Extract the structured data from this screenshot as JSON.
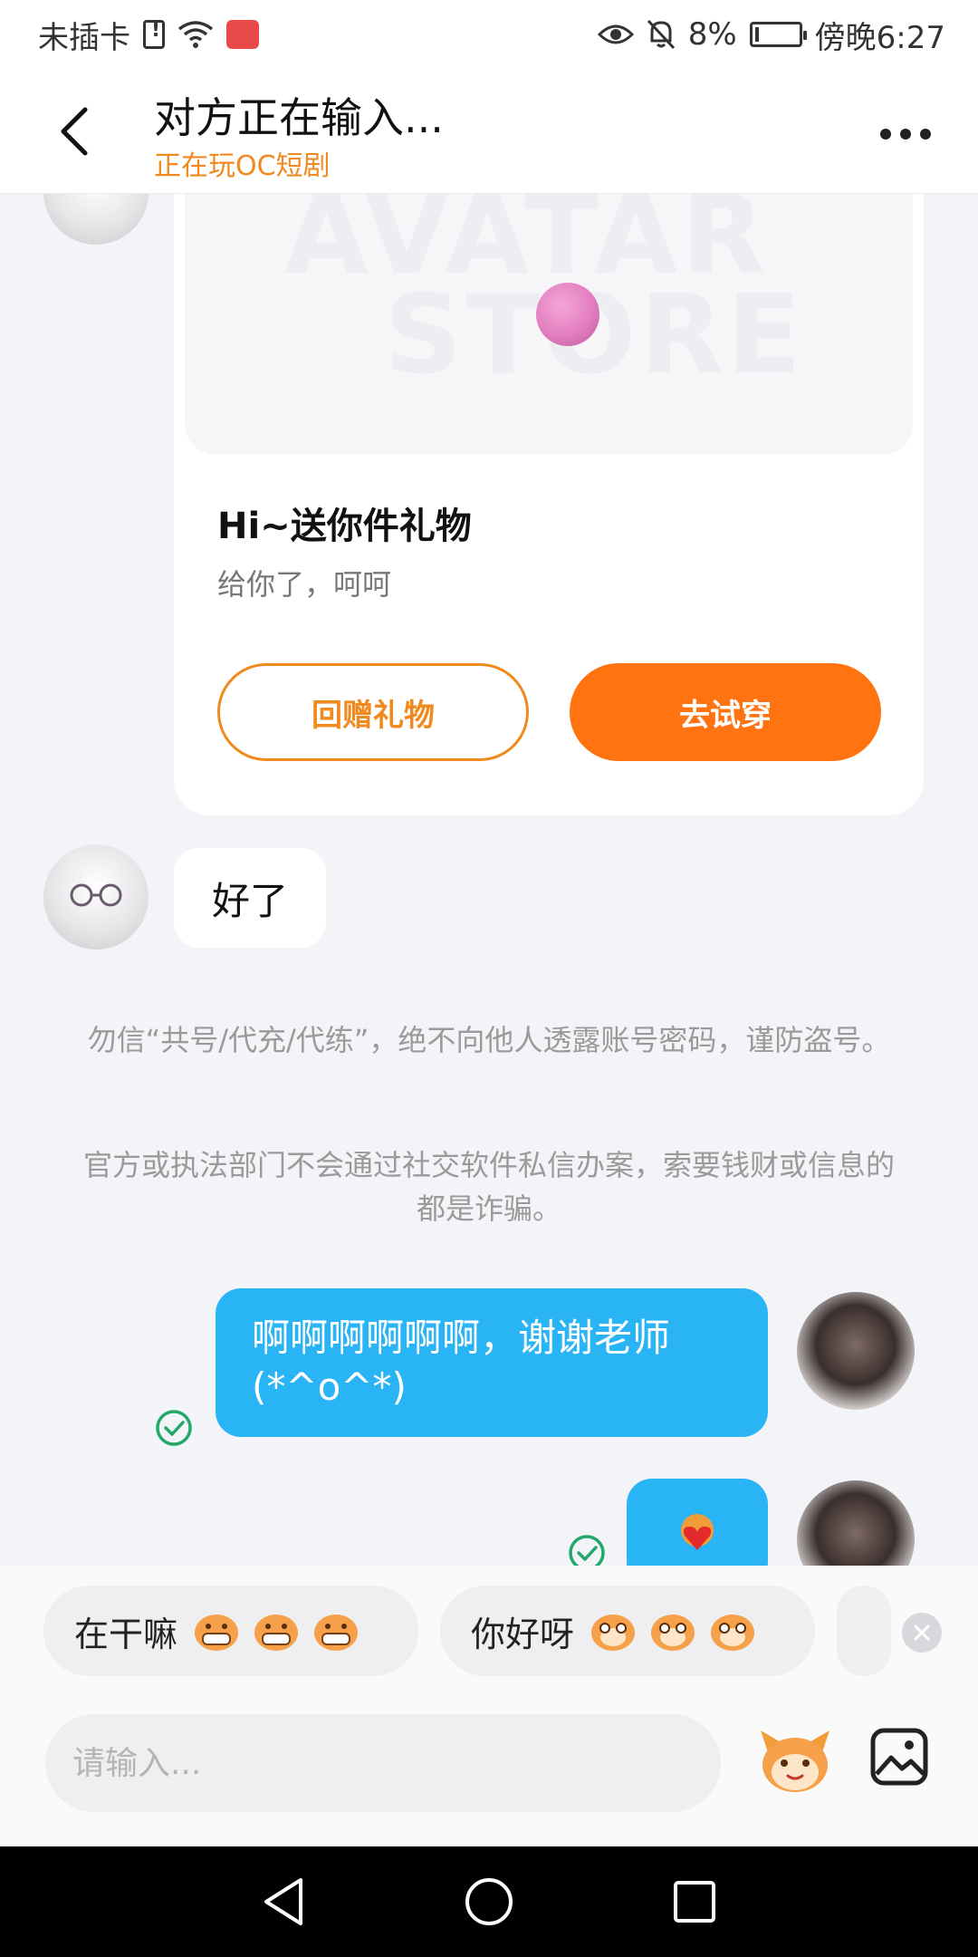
{
  "status_bar": {
    "carrier": "未插卡",
    "battery": "8%",
    "battery_level": 0.08,
    "time": "傍晚6:27"
  },
  "header": {
    "title": "对方正在输入...",
    "subtitle": "正在玩OC短剧"
  },
  "gift_card": {
    "banner_line1": "AVATAR",
    "banner_line2": "STORE",
    "title": "Hi~送你件礼物",
    "description": "给你了，呵呵",
    "return_gift_label": "回赠礼物",
    "try_on_label": "去试穿"
  },
  "messages": {
    "incoming_1": "好了",
    "notice_1": "勿信“共号/代充/代练”，绝不向他人透露账号密码，谨防盗号。",
    "notice_2": "官方或执法部门不会通过社交软件私信办案，索要钱财或信息的都是诈骗。",
    "outgoing_1": "啊啊啊啊啊啊，谢谢老师(*^o^*)"
  },
  "quick_replies": [
    {
      "text": "在干嘛"
    },
    {
      "text": "你好呀"
    }
  ],
  "input": {
    "placeholder": "请输入..."
  },
  "colors": {
    "accent_orange": "#ff7411",
    "subtitle_orange": "#f08a1f",
    "bubble_blue": "#29b4f6",
    "check_green": "#22a86b"
  }
}
